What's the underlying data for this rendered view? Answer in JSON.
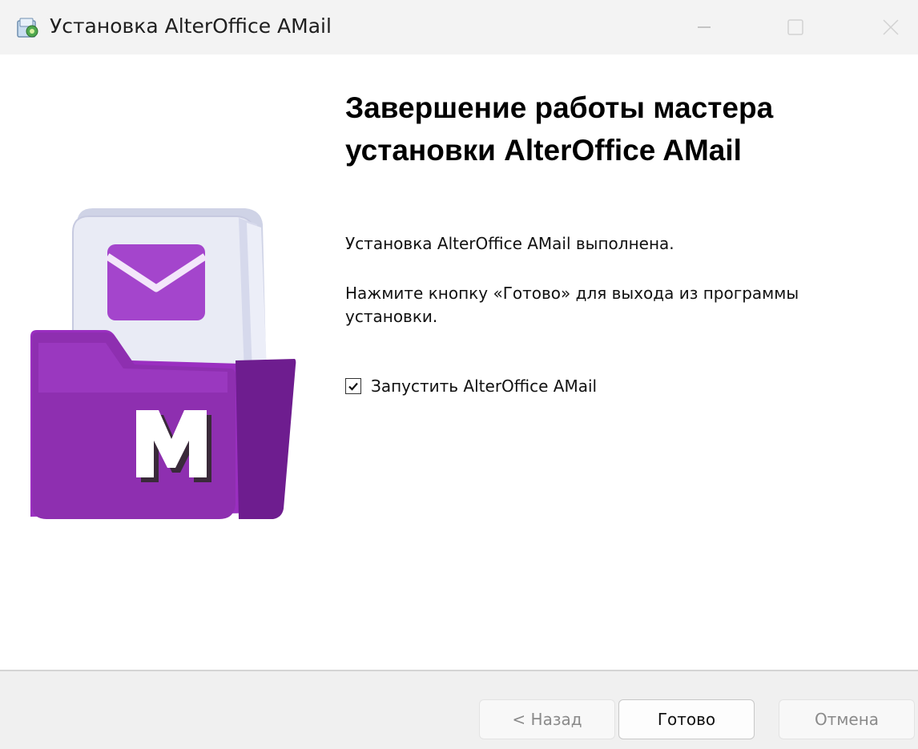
{
  "window": {
    "title": "Установка AlterOffice AMail",
    "icon": "installer-icon",
    "controls": [
      "minimize-icon",
      "maximize-icon",
      "close-icon"
    ]
  },
  "main": {
    "heading_line1": "Завершение работы мастера",
    "heading_line2": "установки AlterOffice AMail",
    "message_done": "Установка AlterOffice AMail выполнена.",
    "message_instructions": "Нажмите кнопку «Готово» для выхода из программы установки.",
    "launch_checkbox": {
      "label": "Запустить AlterOffice AMail",
      "checked": true
    },
    "illustration": {
      "icon": "amail-folder-icon",
      "letter": "M"
    }
  },
  "footer": {
    "back_label": "< Назад",
    "finish_label": "Готово",
    "cancel_label": "Отмена"
  },
  "colors": {
    "accent_purple": "#8e2fb0",
    "envelope_purple": "#a445cc",
    "titlebar_bg": "#f3f3f3",
    "footer_bg": "#f0f0f0"
  }
}
